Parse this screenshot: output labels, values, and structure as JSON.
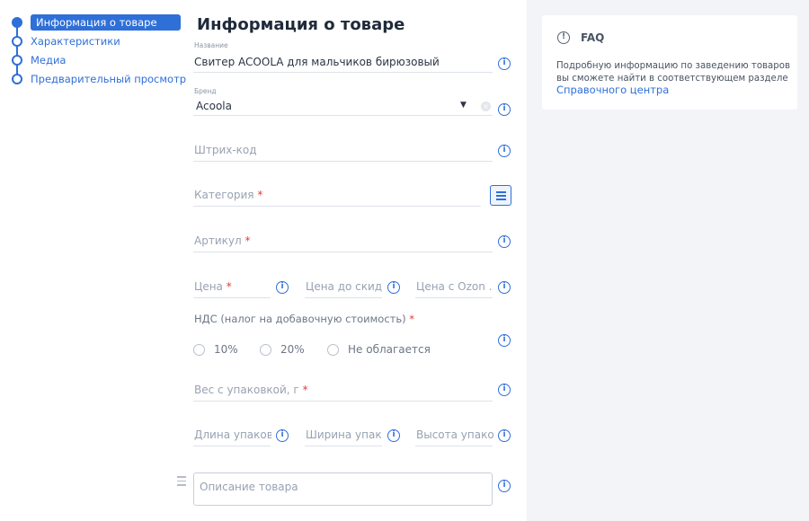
{
  "stepper": {
    "steps": [
      {
        "label": "Информация о товаре",
        "active": true
      },
      {
        "label": "Характеристики",
        "active": false
      },
      {
        "label": "Медиа",
        "active": false
      },
      {
        "label": "Предварительный просмотр",
        "active": false
      }
    ]
  },
  "form": {
    "title": "Информация о товаре",
    "name": {
      "label": "Название",
      "value": "Свитер ACOOLA для мальчиков бирюзовый"
    },
    "brand": {
      "label": "Бренд",
      "value": "Acoola"
    },
    "barcode": {
      "placeholder": "Штрих-код"
    },
    "category": {
      "placeholder": "Категория",
      "required_mark": "*"
    },
    "article": {
      "placeholder": "Артикул",
      "required_mark": "*"
    },
    "price": {
      "placeholder": "Цена",
      "required_mark": "*"
    },
    "price_before_discount": {
      "placeholder": "Цена до скидки"
    },
    "price_ozon": {
      "placeholder": "Цена с Ozon ..."
    },
    "vat": {
      "label": "НДС (налог на добавочную стоимость)",
      "required_mark": "*",
      "options": [
        "10%",
        "20%",
        "Не облагается"
      ]
    },
    "weight": {
      "placeholder": "Вес с упаковкой, г",
      "required_mark": "*"
    },
    "length": {
      "placeholder": "Длина упаков..."
    },
    "width": {
      "placeholder": "Ширина упак..."
    },
    "height": {
      "placeholder": "Высота упако..."
    },
    "description": {
      "placeholder": "Описание товара"
    },
    "info_icon_glyph": "i"
  },
  "faq": {
    "title": "FAQ",
    "text": "Подробную информацию по заведению товаров вы сможете найти в соответствующем разделе",
    "link": "Справочного центра"
  },
  "icons": {
    "info": "info-circle-icon",
    "chevron": "chevron-down-icon",
    "clear": "clear-icon",
    "list": "list-icon",
    "drag": "drag-handle-icon"
  },
  "colors": {
    "accent": "#2f6fd8",
    "required": "#e33a3a",
    "panel_bg": "#f3f4f8"
  }
}
